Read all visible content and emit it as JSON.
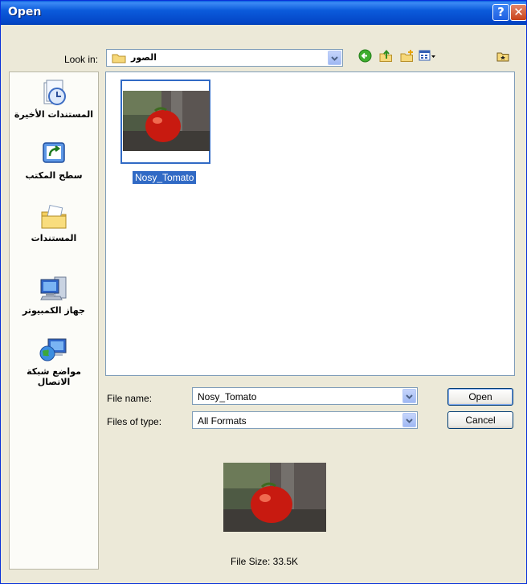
{
  "window": {
    "title": "Open"
  },
  "titlebar": {
    "help_glyph": "?",
    "close_glyph": "✕"
  },
  "look_in": {
    "label": "Look in:",
    "value": "الصور"
  },
  "places": [
    {
      "label": "المستندات الأخيرة",
      "icon": "recent-documents-icon"
    },
    {
      "label": "سطح المكتب",
      "icon": "desktop-icon"
    },
    {
      "label": "المستندات",
      "icon": "my-documents-icon"
    },
    {
      "label": "جهاز الكمبيوتر",
      "icon": "my-computer-icon"
    },
    {
      "label": "مواضع شبكة الاتصال",
      "icon": "network-places-icon"
    }
  ],
  "files": [
    {
      "name": "Nosy_Tomato",
      "selected": true
    }
  ],
  "file_name": {
    "label": "File name:",
    "value": "Nosy_Tomato"
  },
  "files_of_type": {
    "label": "Files of type:",
    "value": "All Formats"
  },
  "buttons": {
    "open": "Open",
    "cancel": "Cancel"
  },
  "preview": {
    "file_size": "File Size: 33.5K"
  },
  "colors": {
    "titlebar": "#0A5FE0",
    "selection": "#316AC5",
    "dialog_bg": "#ECE9D8"
  }
}
